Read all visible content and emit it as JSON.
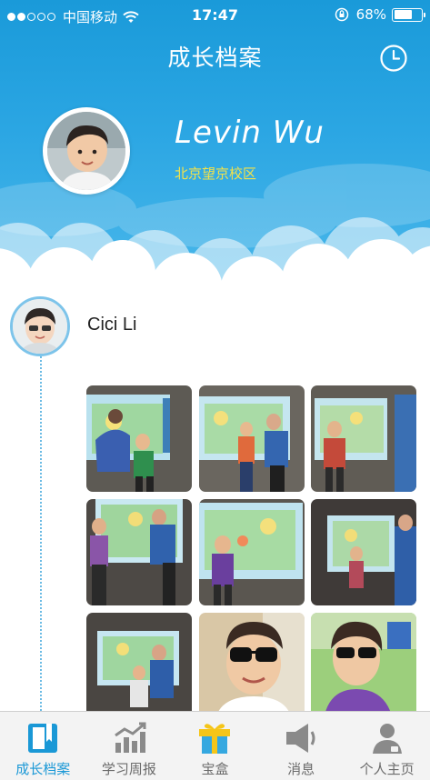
{
  "status_bar": {
    "carrier": "中国移动",
    "time": "17:47",
    "battery_percent": "68%",
    "battery_level": 0.68,
    "signal_bars_filled": 2,
    "signal_bars_total": 5
  },
  "header": {
    "title": "成长档案",
    "history_icon": "clock-icon"
  },
  "profile": {
    "name": "Levin Wu",
    "campus": "北京望京校区"
  },
  "timeline": {
    "entries": [
      {
        "author": "Cici Li",
        "photo_count": 9
      }
    ]
  },
  "tabs": [
    {
      "label": "成长档案",
      "icon": "book-icon",
      "active": true
    },
    {
      "label": "学习周报",
      "icon": "chart-icon",
      "active": false
    },
    {
      "label": "宝盒",
      "icon": "gift-icon",
      "active": false
    },
    {
      "label": "消息",
      "icon": "speaker-icon",
      "active": false
    },
    {
      "label": "个人主页",
      "icon": "person-icon",
      "active": false
    }
  ],
  "colors": {
    "header_blue": "#1a9ad9",
    "campus_yellow": "#f2e24a",
    "tab_active": "#1a98d6",
    "tab_inactive": "#6b6b6b"
  }
}
